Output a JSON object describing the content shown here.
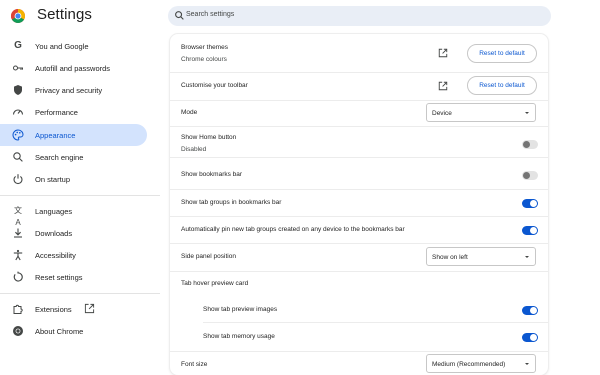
{
  "header": {
    "app_title": "Settings",
    "search_placeholder": "Search settings"
  },
  "sidebar": {
    "items": [
      {
        "label": "You and Google",
        "icon": "google-g-icon"
      },
      {
        "label": "Autofill and passwords",
        "icon": "key-icon"
      },
      {
        "label": "Privacy and security",
        "icon": "shield-icon"
      },
      {
        "label": "Performance",
        "icon": "speedometer-icon"
      },
      {
        "label": "Appearance",
        "icon": "palette-icon",
        "active": true
      },
      {
        "label": "Search engine",
        "icon": "search-icon"
      },
      {
        "label": "On startup",
        "icon": "power-icon"
      },
      {
        "label": "Languages",
        "icon": "translate-icon"
      },
      {
        "label": "Downloads",
        "icon": "download-icon"
      },
      {
        "label": "Accessibility",
        "icon": "accessibility-icon"
      },
      {
        "label": "Reset settings",
        "icon": "reset-icon"
      },
      {
        "label": "Extensions",
        "icon": "puzzle-icon"
      },
      {
        "label": "About Chrome",
        "icon": "chrome-icon"
      }
    ]
  },
  "appearance": {
    "browser_themes": {
      "label": "Browser themes",
      "sublabel": "Chrome colours",
      "button": "Reset to default"
    },
    "customise_toolbar": {
      "label": "Customise your toolbar",
      "button": "Reset to default"
    },
    "mode": {
      "label": "Mode",
      "value": "Device"
    },
    "show_home": {
      "label": "Show Home button",
      "sublabel": "Disabled",
      "enabled": false
    },
    "bookmarks_bar": {
      "label": "Show bookmarks bar",
      "enabled": false
    },
    "tab_groups": {
      "label": "Show tab groups in bookmarks bar",
      "enabled": true
    },
    "auto_pin": {
      "label": "Automatically pin new tab groups created on any device to the bookmarks bar",
      "enabled": true
    },
    "side_panel": {
      "label": "Side panel position",
      "value": "Show on left"
    },
    "tab_hover": {
      "label": "Tab hover preview card"
    },
    "preview_images": {
      "label": "Show tab preview images",
      "enabled": true
    },
    "memory_usage": {
      "label": "Show tab memory usage",
      "enabled": true
    },
    "font_size": {
      "label": "Font size",
      "value": "Medium (Recommended)"
    }
  },
  "colors": {
    "accent": "#0b57d0",
    "active_nav_bg": "#d3e3fd",
    "search_bg": "#e9eef6"
  }
}
